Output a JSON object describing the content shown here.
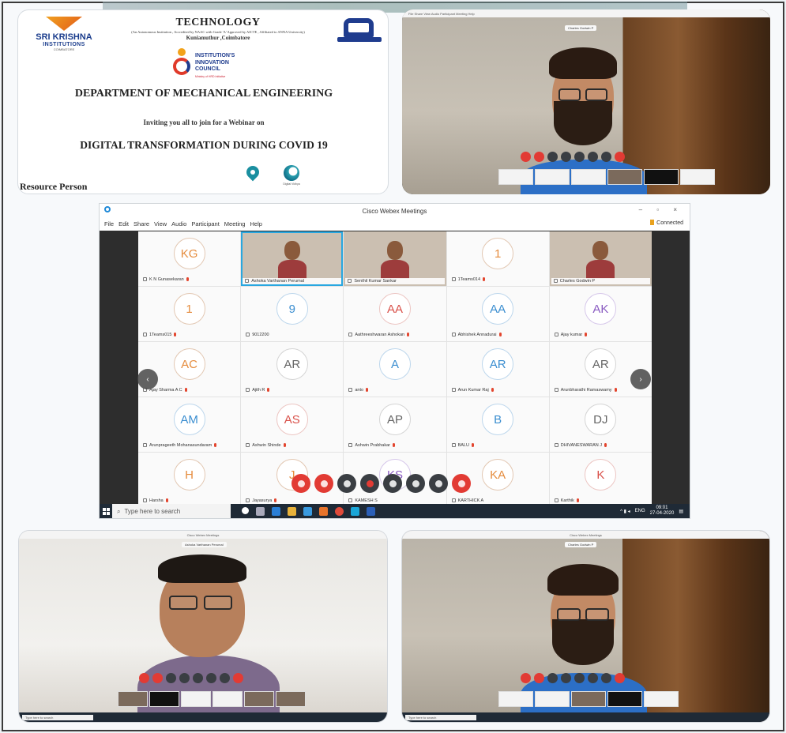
{
  "poster": {
    "logo_left_name": "SRI KRISHNA",
    "logo_left_sub": "INSTITUTIONS",
    "logo_left_city": "COIMBATORE",
    "header_title": "TECHNOLOGY",
    "header_accreditation": "(An Autonomous Institution , Accredited by NAAC with Grade 'A' Approved by AICTE , Affiliated to ANNA University)",
    "header_location": "Kuniamuthur ,Coimbatore",
    "council_line1": "INSTITUTION'S",
    "council_line2": "INNOVATION",
    "council_line3": "COUNCIL",
    "council_sub": "Ministry of HRD Initiative",
    "department": "DEPARTMENT OF  MECHANICAL ENGINEERING",
    "invite": "Inviting you all to join for a Webinar on",
    "topic": "DIGITAL TRANSFORMATION DURING COVID 19",
    "resource_person": "Resource Person",
    "sponsor_caption": "Digital Vidhya"
  },
  "video_top_right": {
    "titlebar": "File  Share  View  Audio  Participant  Meeting  Help",
    "name_tag": "Charles Godwin P",
    "window_label": "Cisco Webex Meetings"
  },
  "webex": {
    "window_title": "Cisco Webex Meetings",
    "window_buttons": "– ▫ ×",
    "menu": [
      "File",
      "Edit",
      "Share",
      "View",
      "Audio",
      "Participant",
      "Meeting",
      "Help"
    ],
    "connection": "Connected",
    "prev_arrow": "‹",
    "next_arrow": "›",
    "participants": [
      {
        "initials": "KG",
        "name": "K N Gunasekaran",
        "type": "avatar",
        "color": "orange",
        "muted": true
      },
      {
        "initials": "",
        "name": "Ashoka Varthanan Perumal",
        "type": "video",
        "active": true,
        "muted": false
      },
      {
        "initials": "",
        "name": "Senthil Kumar Sankar",
        "type": "video",
        "muted": false
      },
      {
        "initials": "1",
        "name": "1Teams014",
        "type": "avatar",
        "color": "orange",
        "muted": true
      },
      {
        "initials": "",
        "name": "Charles Godwin P",
        "type": "video",
        "muted": false
      },
      {
        "initials": "1",
        "name": "1Teams015",
        "type": "avatar",
        "color": "orange",
        "muted": true
      },
      {
        "initials": "9",
        "name": "9012200",
        "type": "avatar",
        "color": "blue",
        "muted": false
      },
      {
        "initials": "AA",
        "name": "Aathreeshwaran Ashokan",
        "type": "avatar",
        "color": "red",
        "muted": true
      },
      {
        "initials": "AA",
        "name": "Abhishek Annadurai",
        "type": "avatar",
        "color": "blue",
        "muted": true
      },
      {
        "initials": "AK",
        "name": "Ajay kumar",
        "type": "avatar",
        "color": "purple",
        "muted": true
      },
      {
        "initials": "AC",
        "name": "Ajay Sharma A C",
        "type": "avatar",
        "color": "orange",
        "muted": true
      },
      {
        "initials": "AR",
        "name": "Ajith R",
        "type": "avatar",
        "color": "gray",
        "muted": true
      },
      {
        "initials": "A",
        "name": "anto",
        "type": "avatar",
        "color": "blue",
        "muted": true
      },
      {
        "initials": "AR",
        "name": "Arun Kumar Raj",
        "type": "avatar",
        "color": "blue",
        "muted": true
      },
      {
        "initials": "AR",
        "name": "Arunbharathi Ramaswamy",
        "type": "avatar",
        "color": "gray",
        "muted": true
      },
      {
        "initials": "AM",
        "name": "Arunprageeth Mohanasundaram",
        "type": "avatar",
        "color": "blue",
        "muted": true
      },
      {
        "initials": "AS",
        "name": "Ashwin Shinde",
        "type": "avatar",
        "color": "red",
        "muted": true
      },
      {
        "initials": "AP",
        "name": "Ashwin Prabhakar",
        "type": "avatar",
        "color": "gray",
        "muted": true
      },
      {
        "initials": "B",
        "name": "BALU",
        "type": "avatar",
        "color": "blue",
        "muted": true
      },
      {
        "initials": "DJ",
        "name": "DHIVANESWARAN J",
        "type": "avatar",
        "color": "gray",
        "muted": true
      },
      {
        "initials": "H",
        "name": "Harsha",
        "type": "avatar",
        "color": "orange",
        "muted": true
      },
      {
        "initials": "J",
        "name": "Jayasurya",
        "type": "avatar",
        "color": "orange",
        "muted": true
      },
      {
        "initials": "KS",
        "name": "KAMESH S",
        "type": "avatar",
        "color": "purple",
        "muted": false
      },
      {
        "initials": "KA",
        "name": "KARTHICK A",
        "type": "avatar",
        "color": "orange",
        "muted": false
      },
      {
        "initials": "K",
        "name": "Karthik",
        "type": "avatar",
        "color": "red",
        "muted": true
      }
    ],
    "controls": [
      "mic",
      "video",
      "share",
      "stop",
      "participants",
      "chat",
      "more",
      "leave"
    ],
    "taskbar": {
      "search_placeholder": "Type here to search",
      "tray_lang": "ENG",
      "time": "09:01",
      "date": "27-04-2020"
    }
  },
  "video_bottom_left": {
    "window_label": "Cisco Webex Meetings",
    "name_tag": "Ashoka Varthanan Perumal",
    "search_placeholder": "Type here to search"
  },
  "video_bottom_right": {
    "window_label": "Cisco Webex Meetings",
    "name_tag": "Charles Godwin P",
    "search_placeholder": "Type here to search"
  },
  "colors": {
    "accent": "#29a7e0",
    "danger": "#e23b34",
    "poster_blue": "#1f3c8e",
    "taskbar": "#1f2a36"
  }
}
